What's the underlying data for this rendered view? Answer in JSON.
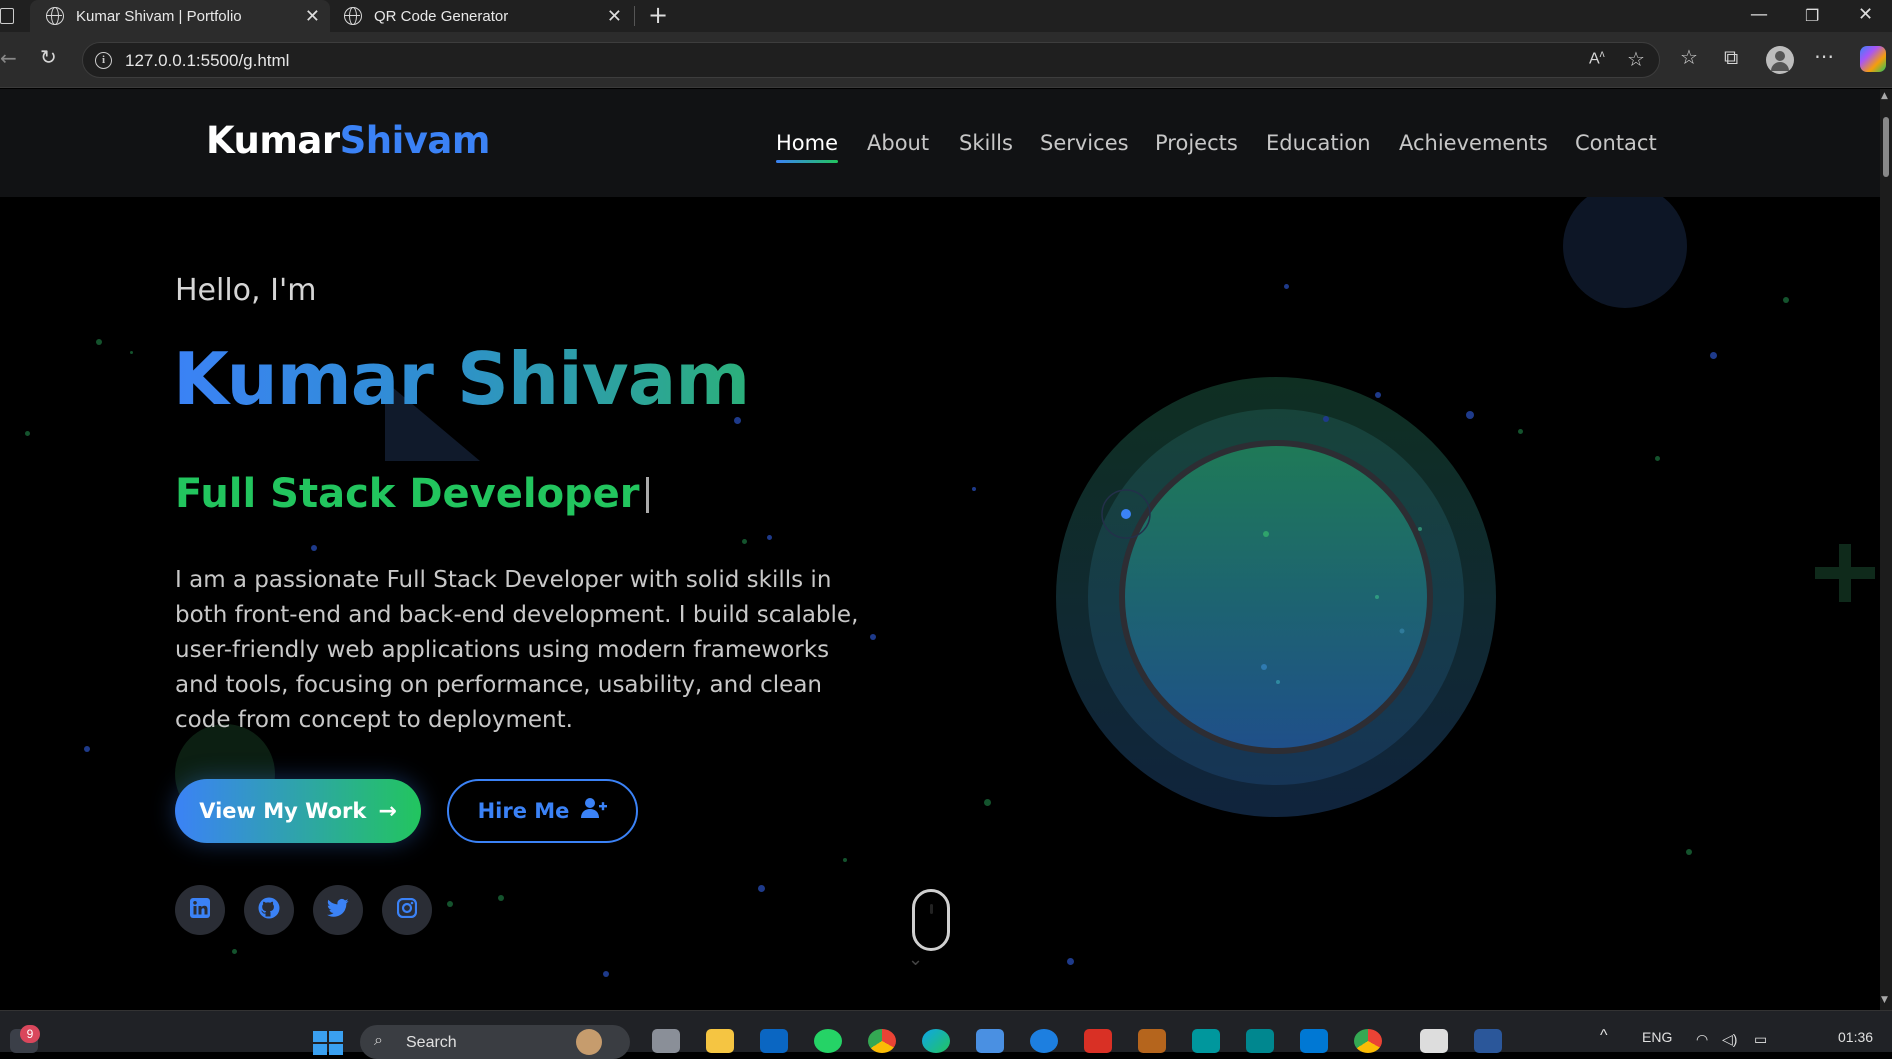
{
  "browser": {
    "tabs": [
      {
        "title": "Kumar Shivam | Portfolio",
        "active": true
      },
      {
        "title": "QR Code Generator",
        "active": false
      }
    ],
    "new_tab_label": "+",
    "url": "127.0.0.1:5500/g.html"
  },
  "site": {
    "logo_first": "Kumar",
    "logo_second": "Shivam",
    "nav": [
      "Home",
      "About",
      "Skills",
      "Services",
      "Projects",
      "Education",
      "Achievements",
      "Contact"
    ],
    "active_nav": "Home"
  },
  "hero": {
    "greeting": "Hello, I'm",
    "name": "Kumar Shivam",
    "role": "Full Stack Developer",
    "bio": "I am a passionate Full Stack Developer with solid skills in both front-end and back-end development. I build scalable, user-friendly web applications using modern frameworks and tools, focusing on performance, usability, and clean code from concept to deployment.",
    "primary_button": "View My Work",
    "secondary_button": "Hire Me",
    "socials": [
      "linkedin-icon",
      "github-icon",
      "twitter-icon",
      "instagram-icon"
    ]
  },
  "colors": {
    "accent_blue": "#3b82f6",
    "accent_green": "#22c55e",
    "navbar_bg": "#111214",
    "page_bg": "#000000"
  },
  "taskbar": {
    "search_label": "Search",
    "notification_count": "9",
    "language": "ENG",
    "time": "01:36"
  }
}
